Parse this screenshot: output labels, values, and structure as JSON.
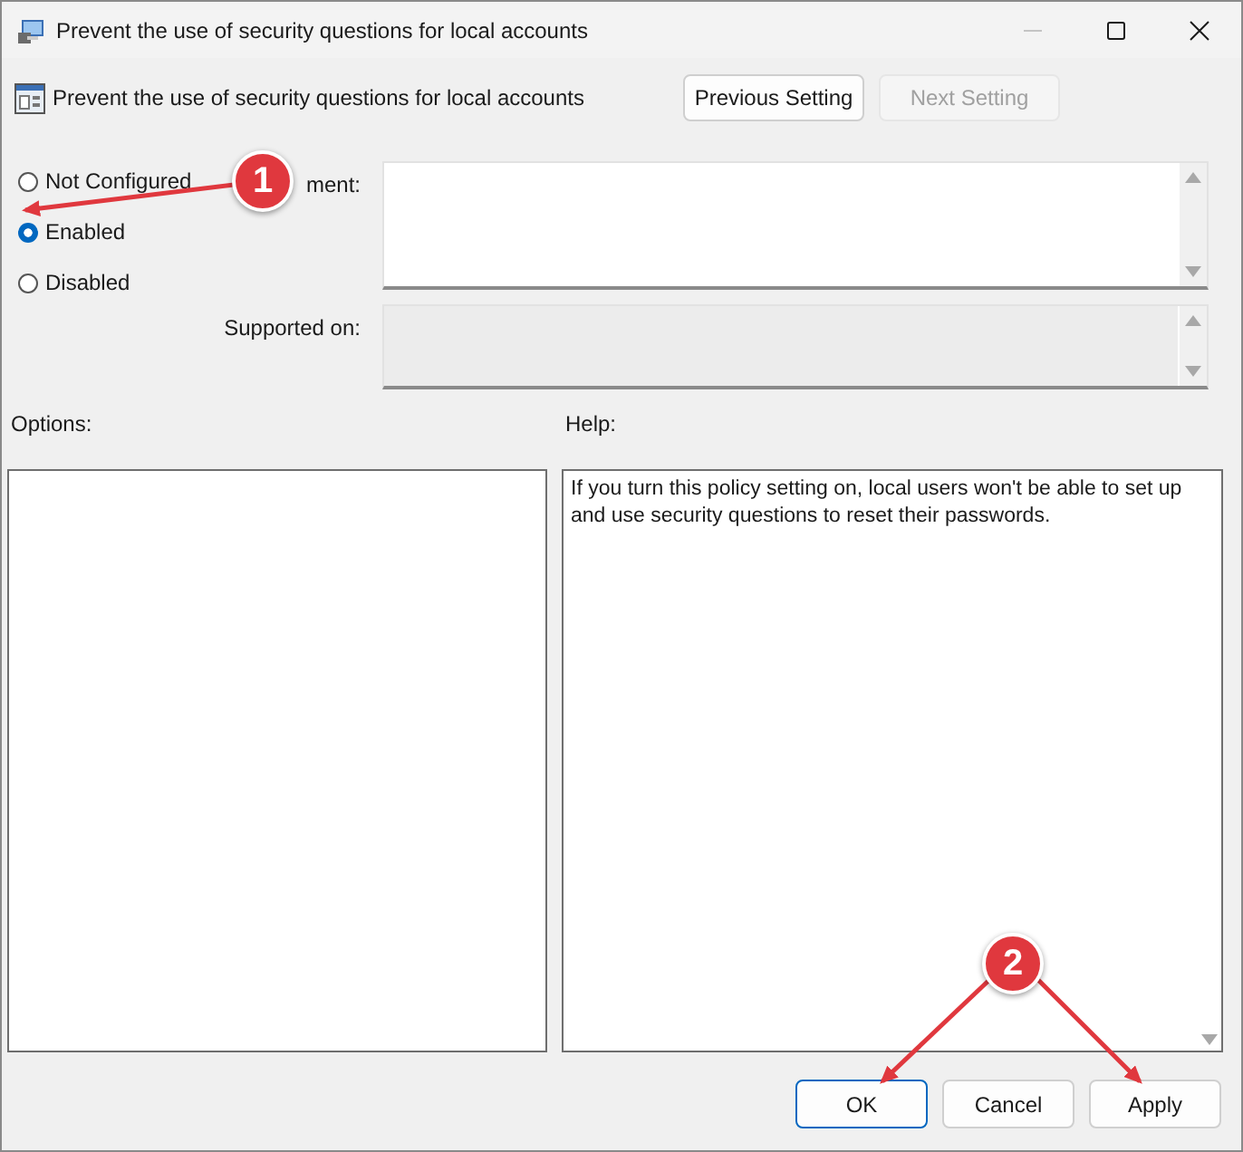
{
  "window": {
    "title": "Prevent the use of security questions for local accounts"
  },
  "setting": {
    "title": "Prevent the use of security questions for local accounts"
  },
  "nav_buttons": [
    {
      "label": "Previous Setting",
      "disabled": false
    },
    {
      "label": "Next Setting",
      "disabled": true
    }
  ],
  "state_options": [
    {
      "label": "Not Configured",
      "selected": false
    },
    {
      "label": "Enabled",
      "selected": true
    },
    {
      "label": "Disabled",
      "selected": false
    }
  ],
  "comment": {
    "label": "ment:"
  },
  "supported_on": {
    "label": "Supported on:"
  },
  "options": {
    "label": "Options:"
  },
  "help": {
    "label": "Help:",
    "text": "If you turn this policy setting on, local users won't be able to set up and use security questions to reset their passwords."
  },
  "buttons": [
    {
      "label": "OK",
      "default": true
    },
    {
      "label": "Cancel",
      "default": false
    },
    {
      "label": "Apply",
      "default": false
    }
  ],
  "annotations": [
    {
      "label": "1"
    },
    {
      "label": "2"
    }
  ]
}
